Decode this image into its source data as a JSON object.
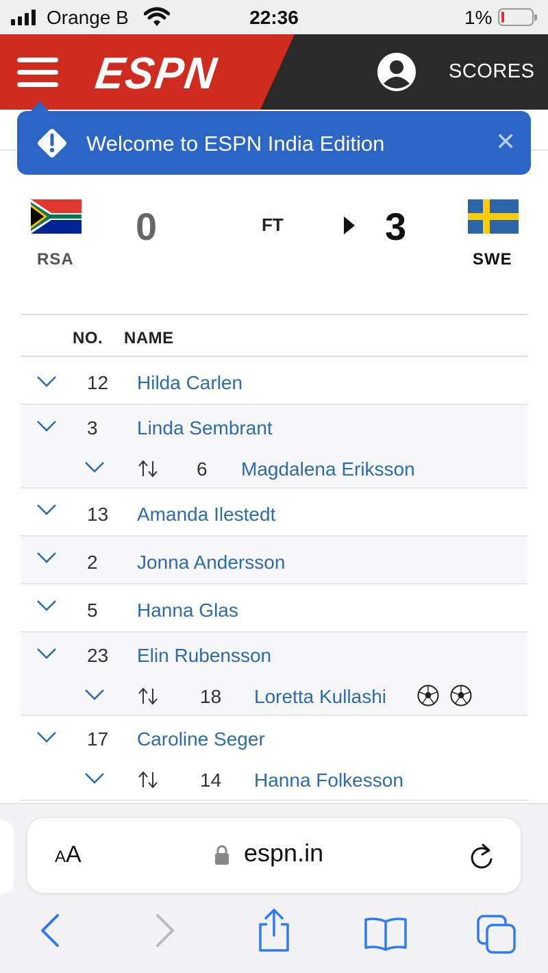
{
  "status_bar": {
    "carrier": "Orange B",
    "time": "22:36",
    "battery_percent": "1%",
    "battery_level": 0.01,
    "icons": [
      "signal-icon",
      "wifi-icon",
      "battery-icon"
    ]
  },
  "header": {
    "logo": "ESPN",
    "scores_label": "SCORES",
    "colors": {
      "brand_red": "#cf2b1e",
      "dark": "#2a2a2a"
    }
  },
  "banner": {
    "text": "Welcome to ESPN India Edition",
    "close_symbol": "✕",
    "color": "#2b66c6"
  },
  "match": {
    "status": "FT",
    "home": {
      "abbr": "RSA",
      "score": "0"
    },
    "away": {
      "abbr": "SWE",
      "score": "3"
    }
  },
  "lineup": {
    "headers": {
      "number": "NO.",
      "name": "NAME"
    },
    "rows": [
      {
        "no": "12",
        "name": "Hilda Carlen"
      },
      {
        "no": "3",
        "name": "Linda Sembrant",
        "sub": {
          "no": "6",
          "name": "Magdalena Eriksson"
        }
      },
      {
        "no": "13",
        "name": "Amanda Ilestedt"
      },
      {
        "no": "2",
        "name": "Jonna Andersson"
      },
      {
        "no": "5",
        "name": "Hanna Glas"
      },
      {
        "no": "23",
        "name": "Elin Rubensson",
        "sub": {
          "no": "18",
          "name": "Loretta Kullashi",
          "goals": 2
        }
      },
      {
        "no": "17",
        "name": "Caroline Seger",
        "sub": {
          "no": "14",
          "name": "Hanna Folkesson"
        }
      }
    ],
    "link_color": "#2d6bab"
  },
  "safari": {
    "text_size_small": "A",
    "text_size_big": "A",
    "url": "espn.in",
    "toolbar_icons": [
      "back-icon",
      "forward-icon",
      "share-icon",
      "bookmarks-icon",
      "tabs-icon"
    ]
  }
}
